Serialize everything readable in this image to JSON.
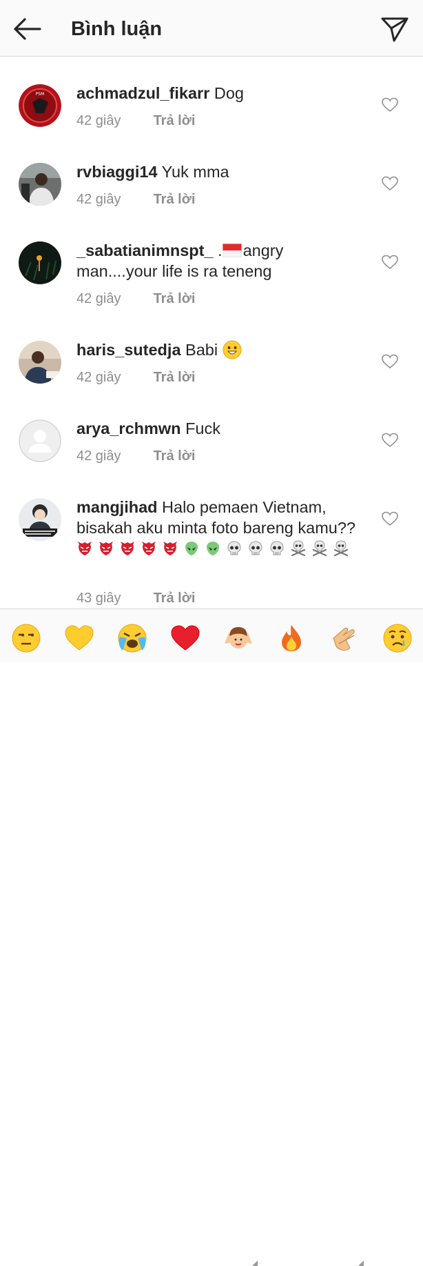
{
  "header": {
    "title": "Bình luận"
  },
  "comments": [
    {
      "username": "achmadzul_fikarr",
      "text": "Dog",
      "time": "42 giây",
      "reply": "Trả lời"
    },
    {
      "username": "rvbiaggi14",
      "text": "Yuk mma",
      "time": "42 giây",
      "reply": "Trả lời"
    },
    {
      "username": "_sabatianimnspt_",
      "text_pre": ".",
      "flag": "indonesia-flag",
      "text": "angry man....your life is ra teneng",
      "time": "42 giây",
      "reply": "Trả lời"
    },
    {
      "username": "haris_sutedja",
      "text": "Babi",
      "emoji": "grinning-face",
      "time": "42 giây",
      "reply": "Trả lời"
    },
    {
      "username": "arya_rchmwn",
      "text": "Fuck",
      "time": "42 giây",
      "reply": "Trả lời"
    },
    {
      "username": "mangjihad",
      "text": "Halo pemaen Vietnam, bisakah aku minta foto bareng kamu??",
      "emojis": [
        "goblin-mask",
        "goblin-mask",
        "goblin-mask",
        "goblin-mask",
        "goblin-mask",
        "alien",
        "alien",
        "skull",
        "skull",
        "skull",
        "skull-crossbones",
        "skull-crossbones",
        "skull-crossbones"
      ],
      "time": "43 giây",
      "reply": "Trả lời"
    }
  ],
  "emoji_bar": [
    "unamused-face",
    "yellow-heart",
    "crying-face",
    "red-heart",
    "raising-hands-person",
    "fire",
    "clapping-hands",
    "disappointed-relieved-face"
  ],
  "colors": {
    "text": "#262626",
    "secondary": "#8e8e8e",
    "divider": "#dbdbdb",
    "header_bg": "#fafafa"
  }
}
